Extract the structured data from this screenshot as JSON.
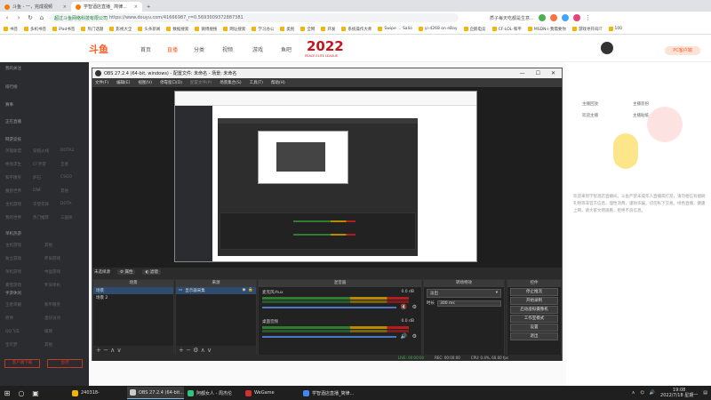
{
  "browser": {
    "tabs": [
      {
        "label": "斗鱼 - 一，完成视频",
        "active": false
      },
      {
        "label": "学智酒店直播_ 简律...",
        "active": true
      },
      {
        "label": "",
        "active": false
      }
    ],
    "url_lock": "不安全",
    "url_host": "www.douyu.com",
    "url_full": "https://www.douyu.com/41666987_r=0.5693009372887381",
    "url_prefix": "超过斗鱼网络科技有限公司",
    "right_info": "质子每天吃都是生意...",
    "bookmarks": [
      "书签",
      "多机书签",
      "iPad书签",
      "热门话题",
      "影视大全",
      "头条新闻",
      "数据搜索",
      "微博搜搜",
      "网址搜索",
      "学习办公",
      "类别",
      "全网",
      "开发",
      "系统操作大师",
      "Swipe ... Salio",
      "yi-4268 on eBay",
      "企鹅电竞",
      "CF-LOL-和平",
      "MSDN-i-我需要你",
      "游戏寻开窍IT",
      "100"
    ]
  },
  "douyu": {
    "logo": "斗鱼",
    "nav": [
      "首页",
      "直播",
      "分类",
      "视频",
      "游戏",
      "鱼吧"
    ],
    "banner": "2022",
    "banner_sub": "PEACE ELITE LEAGUE",
    "sidebar": {
      "top_items": [
        "我的关注",
        "排行榜",
        "赛事",
        "正在直播"
      ],
      "section1_title": "网游竞技",
      "section1": [
        [
          "英雄联盟",
          "穿越火线",
          "DOTA2"
        ],
        [
          "绝地求生",
          "CF手游",
          "王者"
        ],
        [
          "和平精英",
          "炉石",
          "CSGO"
        ],
        [
          "魔兽世界",
          "DNF",
          "其他"
        ],
        [
          "主机游戏",
          "守望先锋",
          "DOTA"
        ],
        [
          "我的世界",
          "热门推荐",
          "三国杀"
        ]
      ],
      "section2_title": "单机热游",
      "section2": [
        [
          "主机游戏",
          "其他"
        ],
        [
          "独立游戏",
          "怀旧游戏"
        ],
        [
          "单机游戏",
          "中国游戏"
        ],
        [
          "暴雪游戏",
          "怀旧单机"
        ]
      ],
      "section3_title": "手游休闲",
      "section3": [
        [
          "王者荣耀",
          "和平精英"
        ],
        [
          "原神",
          "蛋仔派对"
        ],
        [
          "QQ飞车",
          "棋牌"
        ],
        [
          "宝可梦",
          "其他"
        ]
      ],
      "btn1": "客户端下载",
      "btn2": "鱼吧"
    },
    "right": {
      "pc_button": "PC客户端",
      "fb_rows": [
        [
          "主播回放",
          "主播装扮"
        ],
        [
          "欢迎主播",
          "主播贴纸"
        ]
      ],
      "desc_prefix": "欢迎来到学智酒店直播间",
      "desc": "欢迎来到学智酒店直播间，斗鱼严禁未成年人直播或打赏，请勿相信有偿刷礼物等非官方信息，理性消费，谨防诈骗，切勿私下交易。绿色直播，健康上网，请大家文明观看，拒绝不良信息。"
    }
  },
  "obs": {
    "title": "OBS 27.2.4 (64-bit, windows) - 配置文件: 未命名 - 场景: 未命名",
    "menu": [
      "文件(F)",
      "编辑(E)",
      "视图(V)",
      "停靠窗口(D)",
      "配置文件(P)",
      "场景集合(S)",
      "工具(T)",
      "帮助(H)"
    ],
    "scene_label": "未选择源",
    "props_btn": "属性",
    "filters_btn": "滤镜",
    "docks": {
      "scenes_title": "场景",
      "scenes": [
        "场景",
        "场景 2"
      ],
      "sources_title": "来源",
      "sources": [
        "显示器采集"
      ],
      "mixer_title": "混音器",
      "mixer": [
        {
          "name": "麦克风/Aux",
          "db": "0.0 dB",
          "level": 0.85
        },
        {
          "name": "桌面音频",
          "db": "0.0 dB",
          "level": 0.75
        }
      ],
      "transitions_title": "转场特效",
      "transition_value": "淡出",
      "duration_label": "时长",
      "duration_value": "300 ms",
      "controls_title": "控件",
      "controls": [
        "停止推流",
        "开始录制",
        "启动虚拟摄像机",
        "工作室模式",
        "设置",
        "退出"
      ]
    },
    "status": {
      "live": "LIVE: 00:00:00",
      "rec": "REC: 00:00:00",
      "cpu": "CPU: 0.4%, 60.00 fps"
    }
  },
  "taskbar": {
    "apps": [
      {
        "label": "240318-",
        "color": "#f4b400",
        "active": false
      },
      {
        "label": "OBS 27.2.4 (64-bit...",
        "color": "#cccccc",
        "active": true
      },
      {
        "label": "阿都女人 - 周杰伦",
        "color": "#31c27c",
        "active": false
      },
      {
        "label": "WeGame",
        "color": "#d32f2f",
        "active": false
      },
      {
        "label": "学智酒店直播_简律...",
        "color": "#4285f4",
        "active": false
      }
    ],
    "time": "19:08",
    "date": "2022/7/18 星期一"
  }
}
